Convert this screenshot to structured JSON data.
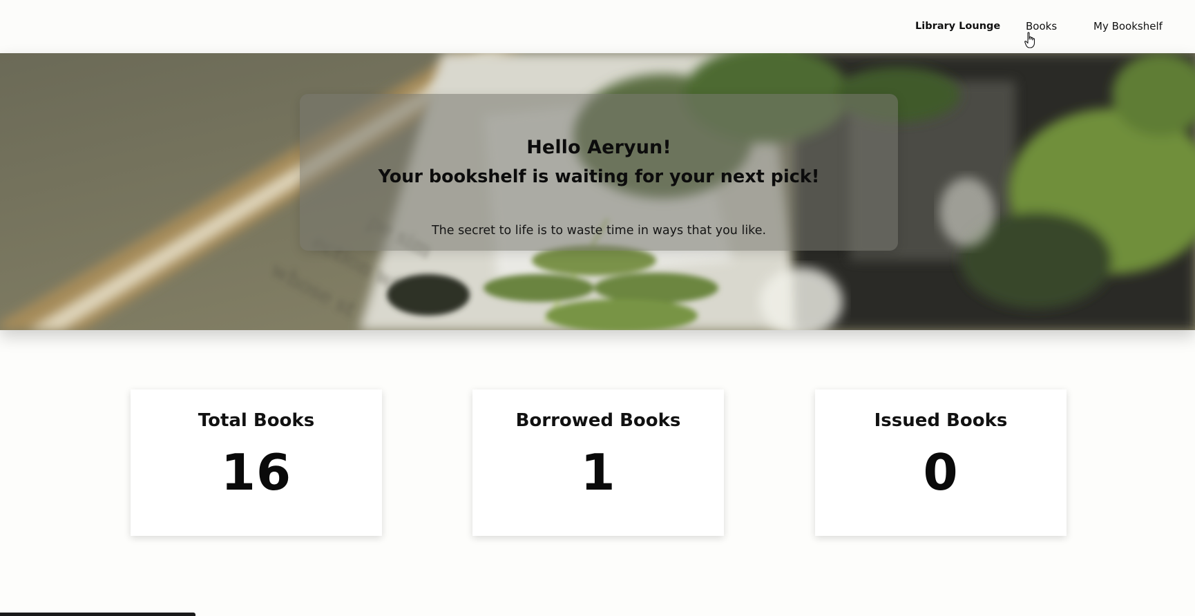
{
  "nav": {
    "brand": "Library Lounge",
    "books": "Books",
    "my_bookshelf": "My Bookshelf"
  },
  "hero": {
    "greeting": "Hello Aeryun!",
    "tagline": "Your bookshelf is waiting for your next pick!",
    "quote": "The secret to life is to waste time in ways that you like."
  },
  "stats": [
    {
      "title": "Total Books",
      "value": "16"
    },
    {
      "title": "Borrowed Books",
      "value": "1"
    },
    {
      "title": "Issued Books",
      "value": "0"
    }
  ],
  "colors": {
    "page_bg": "#fdfdfb",
    "card_bg": "#ffffff",
    "text": "#111111"
  },
  "icons": {
    "cursor": "hand-pointer-icon"
  }
}
